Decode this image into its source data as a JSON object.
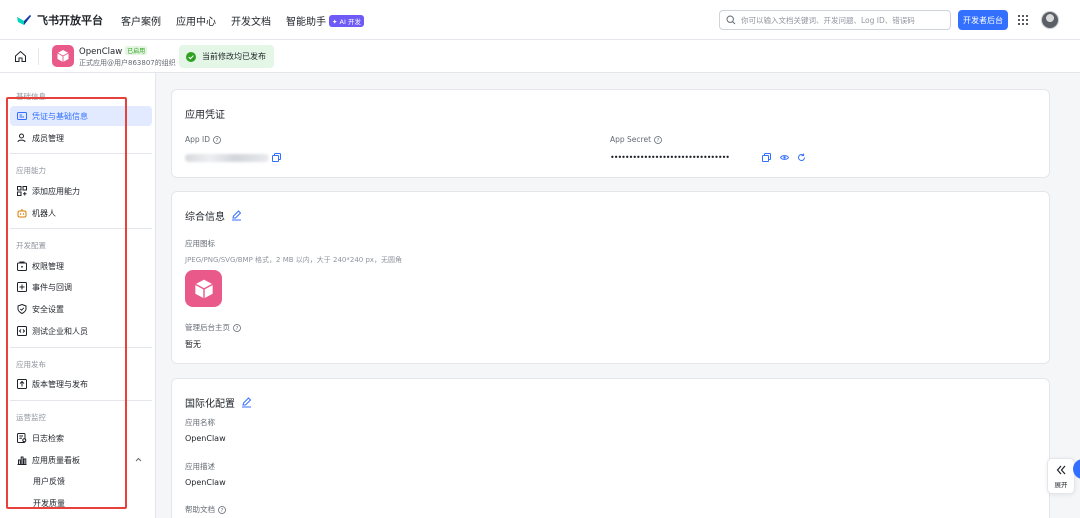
{
  "topnav": {
    "brand": "飞书开放平台",
    "links": [
      "客户案例",
      "应用中心",
      "开发文档",
      "智能助手"
    ],
    "ai_badge": "✦ AI 开发",
    "search_placeholder": "你可以输入文档关键词、开发问题、Log ID、错误码",
    "dev_console": "开发者后台"
  },
  "app": {
    "name": "OpenClaw",
    "status": "已启用",
    "org": "正式应用@用户863807的组织",
    "published": "当前修改均已发布"
  },
  "sidebar": {
    "sections": [
      {
        "title": "基础信息",
        "items": [
          "凭证与基础信息",
          "成员管理"
        ]
      },
      {
        "title": "应用能力",
        "items": [
          "添加应用能力",
          "机器人"
        ]
      },
      {
        "title": "开发配置",
        "items": [
          "权限管理",
          "事件与回调",
          "安全设置",
          "测试企业和人员"
        ]
      },
      {
        "title": "应用发布",
        "items": [
          "版本管理与发布"
        ]
      },
      {
        "title": "运营监控",
        "items": [
          "日志检索",
          "应用质量看板",
          "用户反馈",
          "开发质量"
        ]
      }
    ]
  },
  "credentials": {
    "title": "应用凭证",
    "app_id_label": "App ID",
    "app_secret_label": "App Secret",
    "app_secret_value": "••••••••••••••••••••••••••••••••"
  },
  "general": {
    "title": "综合信息",
    "icon_label": "应用图标",
    "icon_hint": "JPEG/PNG/SVG/BMP 格式，2 MB 以内，大于 240*240 px，无圆角",
    "homepage_label": "管理后台主页",
    "homepage_value": "暂无"
  },
  "i18n": {
    "title": "国际化配置",
    "name_label": "应用名称",
    "name_value": "OpenClaw",
    "desc_label": "应用描述",
    "desc_value": "OpenClaw",
    "help_label": "帮助文档"
  },
  "expand": {
    "label": "展开"
  },
  "colors": {
    "accent": "#3370ff",
    "app_icon": "#e95a8b",
    "highlight_box": "#e8403a",
    "success": "#2ea121"
  }
}
